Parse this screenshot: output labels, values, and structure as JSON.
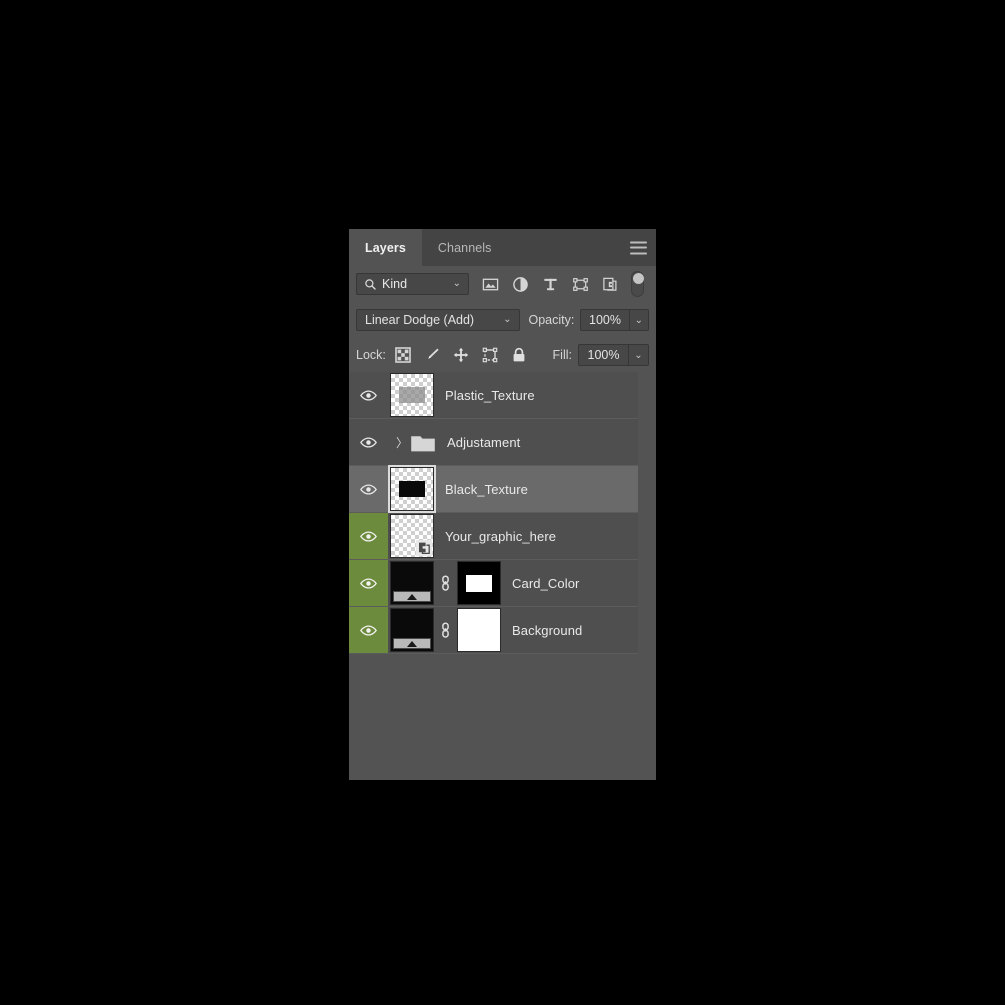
{
  "panel": {
    "tabs": [
      {
        "label": "Layers",
        "active": true
      },
      {
        "label": "Channels",
        "active": false
      }
    ],
    "menu_icon": "hamburger-menu-icon"
  },
  "filter_row": {
    "search_icon": "search-icon",
    "kind_label": "Kind",
    "caret": "⌄",
    "icons": [
      {
        "name": "filter-pixel-icon",
        "title": "Filter for pixel layers"
      },
      {
        "name": "filter-adjustment-icon",
        "title": "Filter for adjustment layers"
      },
      {
        "name": "filter-type-icon",
        "title": "Filter for type layers",
        "glyph": "T"
      },
      {
        "name": "filter-shape-icon",
        "title": "Filter for shape layers"
      },
      {
        "name": "filter-smart-object-icon",
        "title": "Filter for smart objects"
      }
    ],
    "toggle": {
      "name": "filter-enable-toggle",
      "state": "off"
    }
  },
  "blend_row": {
    "blend_mode": "Linear Dodge (Add)",
    "caret": "⌄",
    "opacity_label": "Opacity:",
    "opacity_value": "100%",
    "opacity_caret": "⌄"
  },
  "lock_row": {
    "lock_label": "Lock:",
    "icons": [
      {
        "name": "lock-transparent-pixels-icon"
      },
      {
        "name": "lock-image-pixels-icon"
      },
      {
        "name": "lock-position-icon"
      },
      {
        "name": "lock-artboard-nesting-icon"
      },
      {
        "name": "lock-all-icon"
      }
    ],
    "fill_label": "Fill:",
    "fill_value": "100%",
    "fill_caret": "⌄"
  },
  "layers": [
    {
      "name": "Plastic_Texture",
      "visible": true,
      "selected": false,
      "eye_green": false,
      "thumb_type": "checker-content",
      "has_mask": false
    },
    {
      "name": "Adjustament",
      "visible": true,
      "selected": false,
      "eye_green": false,
      "thumb_type": "group-folder",
      "has_mask": false,
      "expanded": false,
      "disclosure": "〉"
    },
    {
      "name": "Black_Texture",
      "visible": true,
      "selected": true,
      "eye_green": false,
      "thumb_type": "checker-black-rect",
      "has_mask": false
    },
    {
      "name": "Your_graphic_here",
      "visible": true,
      "selected": false,
      "eye_green": true,
      "thumb_type": "smart-object",
      "has_mask": false
    },
    {
      "name": "Card_Color",
      "visible": true,
      "selected": false,
      "eye_green": true,
      "thumb_type": "gradient-map",
      "has_mask": true,
      "mask_type": "black-with-white-rect",
      "link_icon": "link-mask-icon"
    },
    {
      "name": "Background",
      "visible": true,
      "selected": false,
      "eye_green": true,
      "thumb_type": "gradient-map",
      "has_mask": true,
      "mask_type": "white",
      "link_icon": "link-mask-icon"
    }
  ],
  "colors": {
    "panel_bg": "#535353",
    "tabbar_bg": "#444444",
    "row_bg": "#4f4f4f",
    "row_selected_bg": "#6a6a6a",
    "eye_green": "#6d8b3c",
    "field_bg": "#474747",
    "text": "#e9e9e9"
  }
}
